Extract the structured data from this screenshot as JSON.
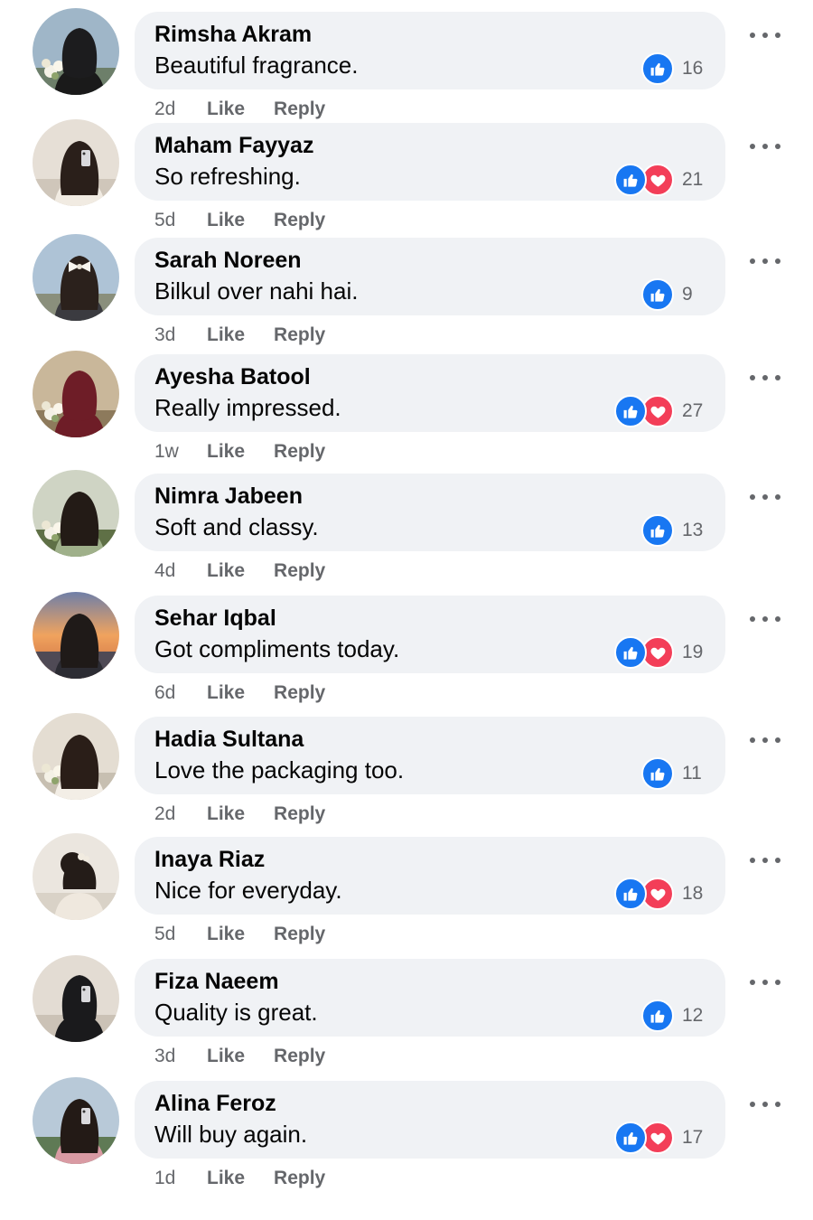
{
  "comments": [
    {
      "name": "Rimsha Akram",
      "text": "Beautiful fragrance.",
      "time": "2d",
      "like_label": "Like",
      "reply_label": "Reply",
      "count": "16",
      "reactions": [
        "like"
      ],
      "avatar": {
        "bg": "#9fb6c8",
        "ground": "#6d7f6a",
        "hair": "#1c1c1e",
        "top": "#1a1a1a",
        "hijab": true,
        "flowers": true
      }
    },
    {
      "name": "Maham Fayyaz",
      "text": "So refreshing.",
      "time": "5d",
      "like_label": "Like",
      "reply_label": "Reply",
      "count": "21",
      "reactions": [
        "like",
        "love"
      ],
      "avatar": {
        "bg": "#e6dfd6",
        "ground": "#cfc6ba",
        "hair": "#2a1f1a",
        "top": "#f1ebe2",
        "phone": true
      }
    },
    {
      "name": "Sarah Noreen",
      "text": "Bilkul over nahi hai.",
      "time": "3d",
      "like_label": "Like",
      "reply_label": "Reply",
      "count": "9",
      "reactions": [
        "like"
      ],
      "avatar": {
        "bg": "#aec3d6",
        "ground": "#8a8f7c",
        "hair": "#2b211c",
        "top": "#3b3b40",
        "bow": true
      }
    },
    {
      "name": "Ayesha Batool",
      "text": "Really impressed.",
      "time": "1w",
      "like_label": "Like",
      "reply_label": "Reply",
      "count": "27",
      "reactions": [
        "like",
        "love"
      ],
      "avatar": {
        "bg": "#c9b79a",
        "ground": "#8d7a5c",
        "hair": "#6e1d27",
        "top": "#6e1d27",
        "hijab": true,
        "flowers": true
      }
    },
    {
      "name": "Nimra Jabeen",
      "text": "Soft and classy.",
      "time": "4d",
      "like_label": "Like",
      "reply_label": "Reply",
      "count": "13",
      "reactions": [
        "like"
      ],
      "avatar": {
        "bg": "#cfd4c4",
        "ground": "#5f7046",
        "hair": "#231b16",
        "top": "#9fb08a",
        "flowers": true
      }
    },
    {
      "name": "Sehar Iqbal",
      "text": "Got compliments today.",
      "time": "6d",
      "like_label": "Like",
      "reply_label": "Reply",
      "count": "19",
      "reactions": [
        "like",
        "love"
      ],
      "avatar": {
        "bg": "#e8a46a",
        "ground": "#4f4a55",
        "hair": "#1f1a18",
        "top": "#2c2c33",
        "sunset": true
      }
    },
    {
      "name": "Hadia Sultana",
      "text": "Love the packaging too.",
      "time": "2d",
      "like_label": "Like",
      "reply_label": "Reply",
      "count": "11",
      "reactions": [
        "like"
      ],
      "avatar": {
        "bg": "#e4ddd2",
        "ground": "#c7bfb1",
        "hair": "#2a1e18",
        "top": "#f3eee6",
        "flowers": true
      }
    },
    {
      "name": "Inaya Riaz",
      "text": "Nice for everyday.",
      "time": "5d",
      "like_label": "Like",
      "reply_label": "Reply",
      "count": "18",
      "reactions": [
        "like",
        "love"
      ],
      "avatar": {
        "bg": "#ebe6df",
        "ground": "#d9d2c7",
        "hair": "#241c18",
        "top": "#efe8de",
        "bun": true
      }
    },
    {
      "name": "Fiza Naeem",
      "text": "Quality is great.",
      "time": "3d",
      "like_label": "Like",
      "reply_label": "Reply",
      "count": "12",
      "reactions": [
        "like"
      ],
      "avatar": {
        "bg": "#e3dcd3",
        "ground": "#cbc2b6",
        "hair": "#1a1a1c",
        "top": "#1a1a1c",
        "hijab": true,
        "phone": true
      }
    },
    {
      "name": "Alina Feroz",
      "text": "Will buy again.",
      "time": "1d",
      "like_label": "Like",
      "reply_label": "Reply",
      "count": "17",
      "reactions": [
        "like",
        "love"
      ],
      "avatar": {
        "bg": "#b8c9d8",
        "ground": "#5f7a55",
        "hair": "#231a16",
        "top": "#d99aa3",
        "phone": true
      }
    }
  ],
  "colors": {
    "like_blue": "#1877f2",
    "love_red": "#f33e58",
    "bubble": "#f0f2f5",
    "meta": "#65676b"
  },
  "icons": {
    "like": "thumbs-up-icon",
    "love": "heart-icon",
    "more": "more-horizontal-icon"
  }
}
